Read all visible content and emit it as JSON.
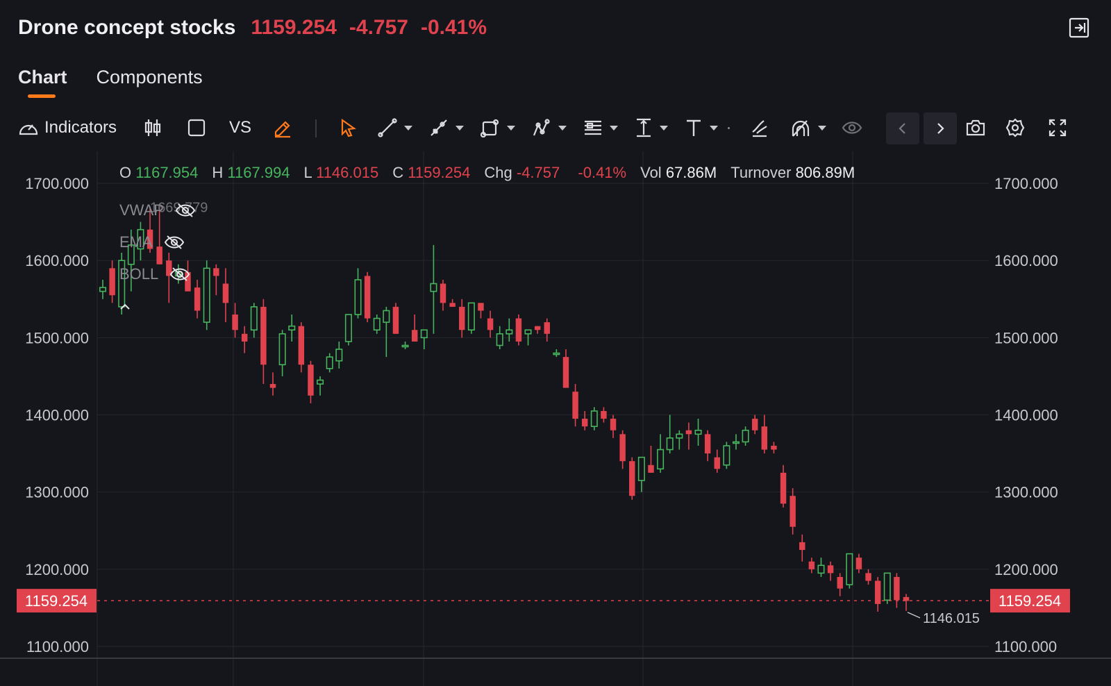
{
  "header": {
    "title": "Drone concept stocks",
    "price": "1159.254",
    "change": "-4.757",
    "change_pct": "-0.41%",
    "price_color": "#e0434e"
  },
  "tabs": [
    {
      "label": "Chart",
      "active": true
    },
    {
      "label": "Components",
      "active": false
    }
  ],
  "toolbar": {
    "indicators_label": "Indicators",
    "vs_label": "VS",
    "icons": [
      "gauge-icon",
      "candlestick-icon",
      "rectangle-icon",
      "pencil-icon",
      "cursor-icon",
      "trend-line-icon",
      "ray-icon",
      "shape-icon",
      "pattern-icon",
      "fib-icon",
      "measure-icon",
      "text-icon",
      "brush-icon",
      "magnet-icon",
      "eye-icon",
      "prev-icon",
      "next-icon",
      "camera-icon",
      "gear-icon",
      "fullscreen-icon"
    ]
  },
  "ohlc": {
    "o_label": "O",
    "o": "1167.954",
    "h_label": "H",
    "h": "1167.994",
    "l_label": "L",
    "l": "1146.015",
    "c_label": "C",
    "c": "1159.254",
    "chg_label": "Chg",
    "chg": "-4.757",
    "chg_pct": "-0.41%",
    "vol_label": "Vol",
    "vol": "67.86M",
    "turnover_label": "Turnover",
    "turnover": "806.89M"
  },
  "indicators": [
    {
      "name": "VWAP",
      "hidden": true
    },
    {
      "name": "EMA",
      "hidden": true
    },
    {
      "name": "BOLL",
      "hidden": true
    }
  ],
  "colors": {
    "up": "#47b45e",
    "down": "#e0434e",
    "accent": "#ff7a1a",
    "grid": "#26272e",
    "axis_text": "#c8c8ce"
  },
  "chart_data": {
    "type": "candlestick",
    "y_ticks": [
      1700,
      1600,
      1500,
      1400,
      1300,
      1200,
      1100
    ],
    "y_tick_labels": [
      "1700.000",
      "1600.000",
      "1500.000",
      "1400.000",
      "1300.000",
      "1200.000",
      "1100.000"
    ],
    "ylim": [
      1085,
      1720
    ],
    "current_price": 1159.254,
    "current_price_label": "1159.254",
    "max_label": "1669.779",
    "min_label": "1146.015",
    "candles": [
      [
        1560,
        1575,
        1550,
        1565
      ],
      [
        1590,
        1600,
        1545,
        1555
      ],
      [
        1540,
        1610,
        1530,
        1600
      ],
      [
        1595,
        1640,
        1560,
        1620
      ],
      [
        1615,
        1650,
        1600,
        1640
      ],
      [
        1640,
        1670,
        1610,
        1615
      ],
      [
        1618,
        1670,
        1600,
        1595
      ],
      [
        1600,
        1610,
        1545,
        1580
      ],
      [
        1580,
        1595,
        1570,
        1585
      ],
      [
        1585,
        1600,
        1570,
        1560
      ],
      [
        1565,
        1575,
        1525,
        1535
      ],
      [
        1520,
        1600,
        1510,
        1590
      ],
      [
        1590,
        1595,
        1555,
        1580
      ],
      [
        1570,
        1590,
        1520,
        1545
      ],
      [
        1530,
        1545,
        1500,
        1510
      ],
      [
        1505,
        1515,
        1480,
        1495
      ],
      [
        1510,
        1545,
        1500,
        1540
      ],
      [
        1540,
        1550,
        1440,
        1465
      ],
      [
        1440,
        1455,
        1425,
        1435
      ],
      [
        1465,
        1510,
        1450,
        1505
      ],
      [
        1510,
        1530,
        1495,
        1515
      ],
      [
        1515,
        1520,
        1455,
        1465
      ],
      [
        1465,
        1470,
        1415,
        1425
      ],
      [
        1440,
        1450,
        1425,
        1445
      ],
      [
        1460,
        1480,
        1455,
        1475
      ],
      [
        1470,
        1495,
        1460,
        1485
      ],
      [
        1495,
        1530,
        1490,
        1530
      ],
      [
        1530,
        1590,
        1525,
        1575
      ],
      [
        1580,
        1585,
        1520,
        1525
      ],
      [
        1510,
        1530,
        1505,
        1525
      ],
      [
        1520,
        1540,
        1475,
        1535
      ],
      [
        1540,
        1545,
        1505,
        1505
      ],
      [
        1490,
        1495,
        1485,
        1490
      ],
      [
        1510,
        1530,
        1495,
        1495
      ],
      [
        1500,
        1510,
        1485,
        1510
      ],
      [
        1560,
        1620,
        1505,
        1570
      ],
      [
        1570,
        1575,
        1535,
        1545
      ],
      [
        1545,
        1550,
        1540,
        1540
      ],
      [
        1540,
        1550,
        1500,
        1510
      ],
      [
        1510,
        1545,
        1505,
        1545
      ],
      [
        1545,
        1545,
        1525,
        1535
      ],
      [
        1525,
        1535,
        1500,
        1510
      ],
      [
        1490,
        1515,
        1485,
        1505
      ],
      [
        1505,
        1525,
        1495,
        1510
      ],
      [
        1525,
        1530,
        1490,
        1495
      ],
      [
        1505,
        1510,
        1490,
        1510
      ],
      [
        1515,
        1515,
        1505,
        1510
      ],
      [
        1520,
        1525,
        1495,
        1505
      ],
      [
        1480,
        1485,
        1475,
        1480
      ],
      [
        1475,
        1485,
        1445,
        1435
      ],
      [
        1430,
        1440,
        1385,
        1395
      ],
      [
        1395,
        1405,
        1380,
        1385
      ],
      [
        1385,
        1410,
        1380,
        1405
      ],
      [
        1405,
        1410,
        1390,
        1395
      ],
      [
        1395,
        1400,
        1370,
        1380
      ],
      [
        1375,
        1380,
        1330,
        1340
      ],
      [
        1340,
        1345,
        1290,
        1295
      ],
      [
        1315,
        1345,
        1300,
        1345
      ],
      [
        1335,
        1360,
        1325,
        1325
      ],
      [
        1330,
        1375,
        1325,
        1355
      ],
      [
        1355,
        1400,
        1350,
        1370
      ],
      [
        1370,
        1380,
        1355,
        1375
      ],
      [
        1380,
        1390,
        1355,
        1375
      ],
      [
        1375,
        1395,
        1360,
        1380
      ],
      [
        1375,
        1380,
        1340,
        1350
      ],
      [
        1345,
        1355,
        1325,
        1330
      ],
      [
        1335,
        1365,
        1330,
        1360
      ],
      [
        1365,
        1375,
        1355,
        1365
      ],
      [
        1365,
        1385,
        1360,
        1380
      ],
      [
        1395,
        1400,
        1375,
        1380
      ],
      [
        1385,
        1400,
        1350,
        1355
      ],
      [
        1360,
        1365,
        1350,
        1355
      ],
      [
        1325,
        1335,
        1280,
        1285
      ],
      [
        1295,
        1305,
        1245,
        1255
      ],
      [
        1235,
        1245,
        1210,
        1225
      ],
      [
        1210,
        1215,
        1195,
        1200
      ],
      [
        1195,
        1215,
        1190,
        1205
      ],
      [
        1205,
        1210,
        1185,
        1195
      ],
      [
        1190,
        1195,
        1165,
        1175
      ],
      [
        1180,
        1220,
        1175,
        1220
      ],
      [
        1215,
        1220,
        1195,
        1200
      ],
      [
        1195,
        1200,
        1180,
        1185
      ],
      [
        1185,
        1190,
        1145,
        1155
      ],
      [
        1160,
        1195,
        1155,
        1195
      ],
      [
        1190,
        1195,
        1150,
        1160
      ],
      [
        1164,
        1168,
        1146,
        1159
      ]
    ]
  }
}
